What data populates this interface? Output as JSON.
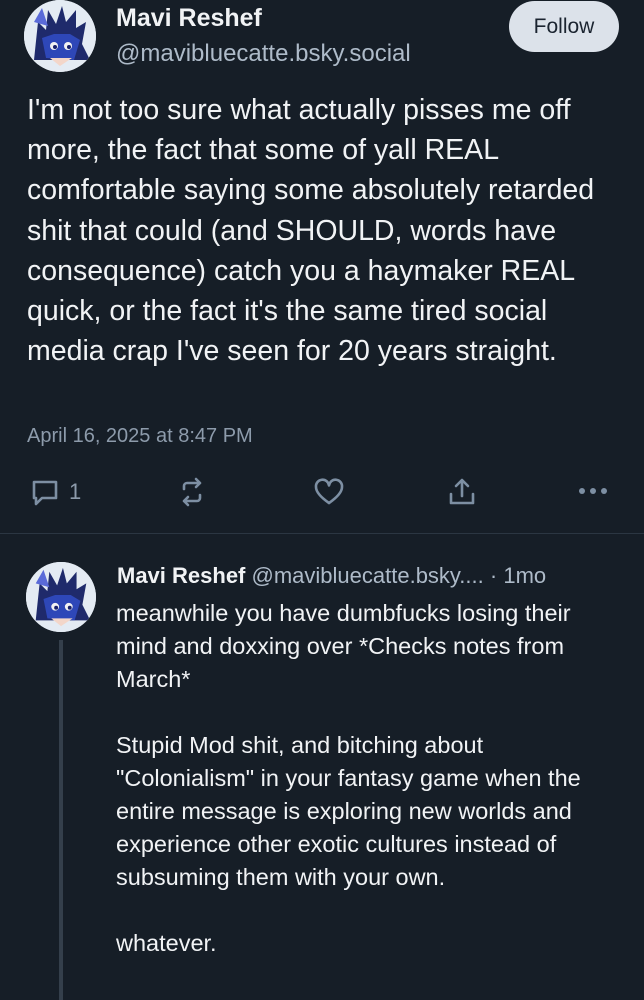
{
  "post": {
    "author_name": "Mavi Reshef",
    "author_handle": "@mavibluecatte.bsky.social",
    "follow_label": "Follow",
    "text": "I'm not too sure what actually pisses me off more, the fact that some of yall REAL comfortable saying some absolutely retarded shit that could (and SHOULD, words have consequence) catch you a haymaker REAL quick, or the fact it's the same tired social media crap I've seen for 20 years straight.",
    "date": "April 16, 2025 at 8:47 PM",
    "reply_count": "1",
    "icons": {
      "reply": "reply-icon",
      "repost": "repost-icon",
      "like": "heart-icon",
      "share": "share-icon",
      "more": "more-icon"
    }
  },
  "reply": {
    "author_name": "Mavi Reshef",
    "author_handle": "@mavibluecatte.bsky....",
    "separator": " · ",
    "time": "1mo",
    "paragraphs": [
      "meanwhile you have dumbfucks losing their mind and doxxing over *Checks notes from March*",
      "Stupid Mod shit, and bitching about \"Colonialism\" in your fantasy game when the entire message is exploring new worlds and experience other exotic cultures instead of subsuming them with your own.",
      "whatever."
    ]
  },
  "colors": {
    "background": "#161e27",
    "text": "#f1f3f5",
    "muted": "#8d9bab",
    "follow_button": "#dce2ea",
    "icon": "#7d8fa3"
  }
}
